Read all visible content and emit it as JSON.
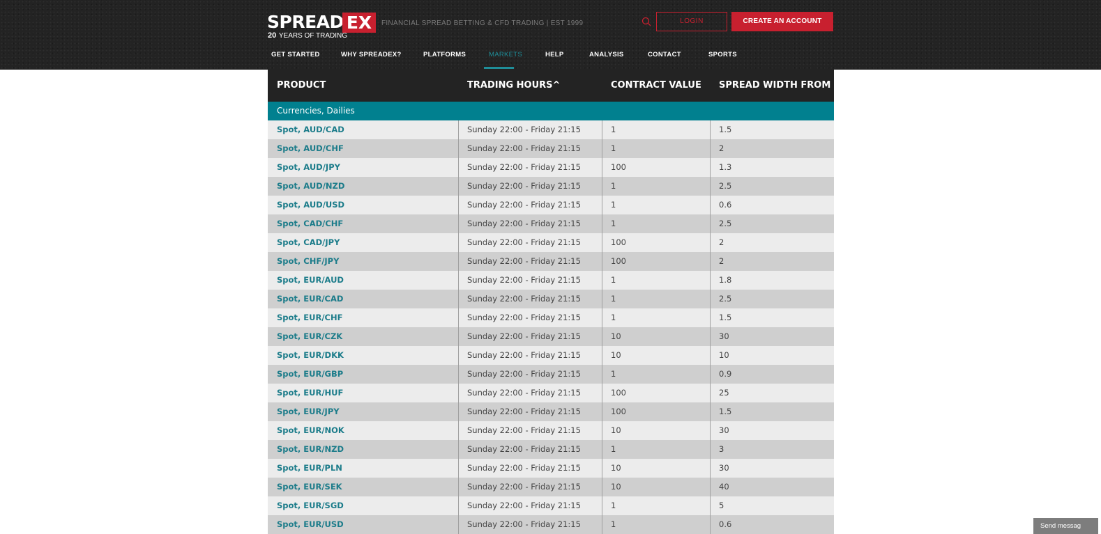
{
  "brand": {
    "logo_spread": "SPREAD",
    "logo_ex": "EX",
    "years_num": "20",
    "years_text": "YEARS OF TRADING",
    "tagline": "FINANCIAL SPREAD BETTING & CFD TRADING | EST 1999",
    "red": "#c8202f",
    "teal": "#01808f"
  },
  "header": {
    "login_label": "LOGIN",
    "create_account_label": "CREATE AN ACCOUNT",
    "search_icon": "search-icon"
  },
  "nav": {
    "items": [
      {
        "label": "GET STARTED"
      },
      {
        "label": "WHY SPREADEX?"
      },
      {
        "label": "PLATFORMS"
      },
      {
        "label": "MARKETS"
      },
      {
        "label": "HELP"
      },
      {
        "label": "ANALYSIS"
      },
      {
        "label": "CONTACT"
      },
      {
        "label": "SPORTS"
      }
    ],
    "active": "MARKETS"
  },
  "table": {
    "headers": [
      "PRODUCT",
      "TRADING HOURS^",
      "CONTRACT VALUE",
      "SPREAD WIDTH FROM"
    ],
    "section": "Currencies, Dailies",
    "rows": [
      {
        "product": "Spot, AUD/CAD",
        "hours": "Sunday 22:00 - Friday 21:15",
        "contract": "1",
        "spread": "1.5"
      },
      {
        "product": "Spot, AUD/CHF",
        "hours": "Sunday 22:00 - Friday 21:15",
        "contract": "1",
        "spread": "2"
      },
      {
        "product": "Spot, AUD/JPY",
        "hours": "Sunday 22:00 - Friday 21:15",
        "contract": "100",
        "spread": "1.3"
      },
      {
        "product": "Spot, AUD/NZD",
        "hours": "Sunday 22:00 - Friday 21:15",
        "contract": "1",
        "spread": "2.5"
      },
      {
        "product": "Spot, AUD/USD",
        "hours": "Sunday 22:00 - Friday 21:15",
        "contract": "1",
        "spread": "0.6"
      },
      {
        "product": "Spot, CAD/CHF",
        "hours": "Sunday 22:00 - Friday 21:15",
        "contract": "1",
        "spread": "2.5"
      },
      {
        "product": "Spot, CAD/JPY",
        "hours": "Sunday 22:00 - Friday 21:15",
        "contract": "100",
        "spread": "2"
      },
      {
        "product": "Spot, CHF/JPY",
        "hours": "Sunday 22:00 - Friday 21:15",
        "contract": "100",
        "spread": "2"
      },
      {
        "product": "Spot, EUR/AUD",
        "hours": "Sunday 22:00 - Friday 21:15",
        "contract": "1",
        "spread": "1.8"
      },
      {
        "product": "Spot, EUR/CAD",
        "hours": "Sunday 22:00 - Friday 21:15",
        "contract": "1",
        "spread": "2.5"
      },
      {
        "product": "Spot, EUR/CHF",
        "hours": "Sunday 22:00 - Friday 21:15",
        "contract": "1",
        "spread": "1.5"
      },
      {
        "product": "Spot, EUR/CZK",
        "hours": "Sunday 22:00 - Friday 21:15",
        "contract": "10",
        "spread": "30"
      },
      {
        "product": "Spot, EUR/DKK",
        "hours": "Sunday 22:00 - Friday 21:15",
        "contract": "10",
        "spread": "10"
      },
      {
        "product": "Spot, EUR/GBP",
        "hours": "Sunday 22:00 - Friday 21:15",
        "contract": "1",
        "spread": "0.9"
      },
      {
        "product": "Spot, EUR/HUF",
        "hours": "Sunday 22:00 - Friday 21:15",
        "contract": "100",
        "spread": "25"
      },
      {
        "product": "Spot, EUR/JPY",
        "hours": "Sunday 22:00 - Friday 21:15",
        "contract": "100",
        "spread": "1.5"
      },
      {
        "product": "Spot, EUR/NOK",
        "hours": "Sunday 22:00 - Friday 21:15",
        "contract": "10",
        "spread": "30"
      },
      {
        "product": "Spot, EUR/NZD",
        "hours": "Sunday 22:00 - Friday 21:15",
        "contract": "1",
        "spread": "3"
      },
      {
        "product": "Spot, EUR/PLN",
        "hours": "Sunday 22:00 - Friday 21:15",
        "contract": "10",
        "spread": "30"
      },
      {
        "product": "Spot, EUR/SEK",
        "hours": "Sunday 22:00 - Friday 21:15",
        "contract": "10",
        "spread": "40"
      },
      {
        "product": "Spot, EUR/SGD",
        "hours": "Sunday 22:00 - Friday 21:15",
        "contract": "1",
        "spread": "5"
      },
      {
        "product": "Spot, EUR/USD",
        "hours": "Sunday 22:00 - Friday 21:15",
        "contract": "1",
        "spread": "0.6"
      }
    ]
  },
  "chat": {
    "label": "Send messag"
  }
}
